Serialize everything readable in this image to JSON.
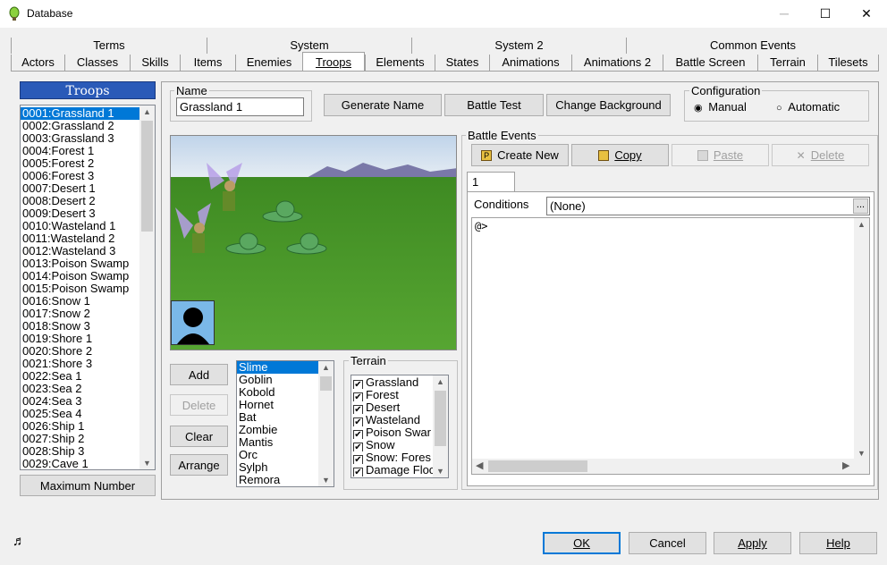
{
  "window": {
    "title": "Database",
    "minimize": "─",
    "maximize": "☐",
    "close": "✕"
  },
  "tabs_top": [
    "Terms",
    "System",
    "System 2",
    "Common Events"
  ],
  "tabs_bottom": [
    "Actors",
    "Classes",
    "Skills",
    "Items",
    "Enemies",
    "Troops",
    "Elements",
    "States",
    "Animations",
    "Animations 2",
    "Battle Screen",
    "Terrain",
    "Tilesets"
  ],
  "troops": {
    "header": "Troops",
    "items": [
      "0001:Grassland 1",
      "0002:Grassland 2",
      "0003:Grassland 3",
      "0004:Forest 1",
      "0005:Forest 2",
      "0006:Forest 3",
      "0007:Desert 1",
      "0008:Desert 2",
      "0009:Desert 3",
      "0010:Wasteland 1",
      "0011:Wasteland 2",
      "0012:Wasteland 3",
      "0013:Poison Swamp",
      "0014:Poison Swamp",
      "0015:Poison Swamp",
      "0016:Snow 1",
      "0017:Snow 2",
      "0018:Snow 3",
      "0019:Shore 1",
      "0020:Shore 2",
      "0021:Shore 3",
      "0022:Sea 1",
      "0023:Sea 2",
      "0024:Sea 3",
      "0025:Sea 4",
      "0026:Ship 1",
      "0027:Ship 2",
      "0028:Ship 3",
      "0029:Cave 1"
    ],
    "max_button": "Maximum Number"
  },
  "name": {
    "legend": "Name",
    "value": "Grassland 1"
  },
  "buttons": {
    "generate": "Generate Name",
    "battle_test": "Battle Test",
    "change_bg": "Change Background"
  },
  "configuration": {
    "legend": "Configuration",
    "manual": "Manual",
    "automatic": "Automatic"
  },
  "member_buttons": {
    "add": "Add",
    "delete": "Delete",
    "clear": "Clear",
    "arrange": "Arrange"
  },
  "monsters": [
    "Slime",
    "Goblin",
    "Kobold",
    "Hornet",
    "Bat",
    "Zombie",
    "Mantis",
    "Orc",
    "Sylph",
    "Remora"
  ],
  "terrain": {
    "legend": "Terrain",
    "items": [
      "Grassland",
      "Forest",
      "Desert",
      "Wasteland",
      "Poison Swar",
      "Snow",
      "Snow: Fores",
      "Damage Floo"
    ]
  },
  "battle_events": {
    "legend": "Battle Events",
    "create_new": "Create New",
    "copy": "Copy",
    "paste": "Paste",
    "delete": "Delete",
    "page_tab": "1",
    "conditions_label": "Conditions",
    "conditions_value": "(None)",
    "ellipsis": "...",
    "first_line": "@>"
  },
  "footer": {
    "ok": "OK",
    "cancel": "Cancel",
    "apply": "Apply",
    "help": "Help"
  },
  "colors": {
    "accent": "#0078d7",
    "list_header": "#2a5ab8",
    "grass": "#4e9a2e",
    "sky": "#d8e6f2"
  }
}
